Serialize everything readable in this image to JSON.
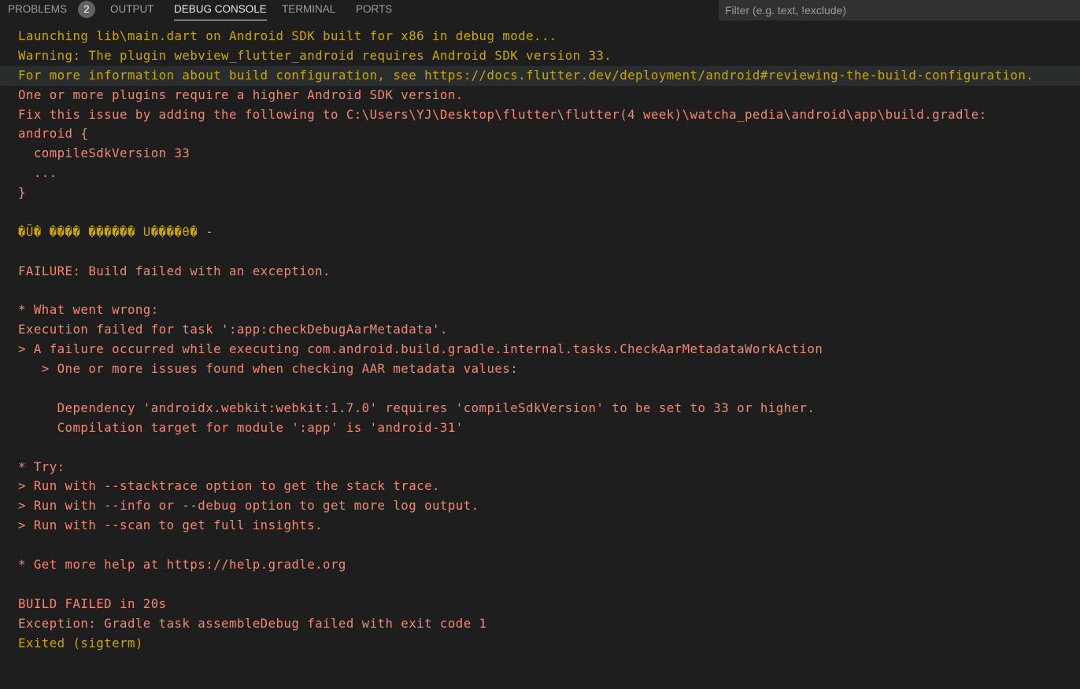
{
  "tabs": [
    {
      "label": "PROBLEMS",
      "badge": "2"
    },
    {
      "label": "OUTPUT"
    },
    {
      "label": "DEBUG CONSOLE"
    },
    {
      "label": "TERMINAL"
    },
    {
      "label": "PORTS"
    }
  ],
  "active_tab": "DEBUG CONSOLE",
  "filter": {
    "placeholder": "Filter (e.g. text, !exclude)",
    "value": ""
  },
  "colors": {
    "background": "#1e1e1e",
    "warning": "#cca700",
    "error": "#f48771",
    "tab_active": "#e7e7e7",
    "tab_inactive": "#9d9d9d"
  },
  "console": {
    "lines": [
      {
        "text": "Launching lib\\main.dart on Android SDK built for x86 in debug mode...",
        "color": "#cca700"
      },
      {
        "text": "Warning: The plugin webview_flutter_android requires Android SDK version 33.",
        "color": "#cca700"
      },
      {
        "text": "For more information about build configuration, see https://docs.flutter.dev/deployment/android#reviewing-the-build-configuration.",
        "color": "#cca700",
        "highlight": true
      },
      {
        "text": "One or more plugins require a higher Android SDK version.",
        "color": "#f48771"
      },
      {
        "text": "Fix this issue by adding the following to C:\\Users\\YJ\\Desktop\\flutter\\flutter(4 week)\\watcha_pedia\\android\\app\\build.gradle:",
        "color": "#f48771"
      },
      {
        "text": "android {",
        "color": "#f48771"
      },
      {
        "text": "  compileSdkVersion 33",
        "color": "#f48771"
      },
      {
        "text": "  ...",
        "color": "#f48771"
      },
      {
        "text": "}",
        "color": "#f48771"
      },
      {
        "text": "",
        "color": "#f48771"
      },
      {
        "text": "�Ũ� ���� ������ U����θ� -",
        "color": "#cca700"
      },
      {
        "text": "",
        "color": "#f48771"
      },
      {
        "text": "FAILURE: Build failed with an exception.",
        "color": "#f48771"
      },
      {
        "text": "",
        "color": "#f48771"
      },
      {
        "text": "* What went wrong:",
        "color": "#f48771"
      },
      {
        "text": "Execution failed for task ':app:checkDebugAarMetadata'.",
        "color": "#f48771"
      },
      {
        "text": "> A failure occurred while executing com.android.build.gradle.internal.tasks.CheckAarMetadataWorkAction",
        "color": "#f48771"
      },
      {
        "text": "   > One or more issues found when checking AAR metadata values:",
        "color": "#f48771"
      },
      {
        "text": "",
        "color": "#f48771"
      },
      {
        "text": "     Dependency 'androidx.webkit:webkit:1.7.0' requires 'compileSdkVersion' to be set to 33 or higher.",
        "color": "#f48771"
      },
      {
        "text": "     Compilation target for module ':app' is 'android-31'",
        "color": "#f48771"
      },
      {
        "text": "",
        "color": "#f48771"
      },
      {
        "text": "* Try:",
        "color": "#f48771"
      },
      {
        "text": "> Run with --stacktrace option to get the stack trace.",
        "color": "#f48771"
      },
      {
        "text": "> Run with --info or --debug option to get more log output.",
        "color": "#f48771"
      },
      {
        "text": "> Run with --scan to get full insights.",
        "color": "#f48771"
      },
      {
        "text": "",
        "color": "#f48771"
      },
      {
        "text": "* Get more help at https://help.gradle.org",
        "color": "#f48771"
      },
      {
        "text": "",
        "color": "#f48771"
      },
      {
        "text": "BUILD FAILED in 20s",
        "color": "#f48771"
      },
      {
        "text": "Exception: Gradle task assembleDebug failed with exit code 1",
        "color": "#f48771"
      },
      {
        "text": "Exited (sigterm)",
        "color": "#cca700"
      }
    ]
  }
}
